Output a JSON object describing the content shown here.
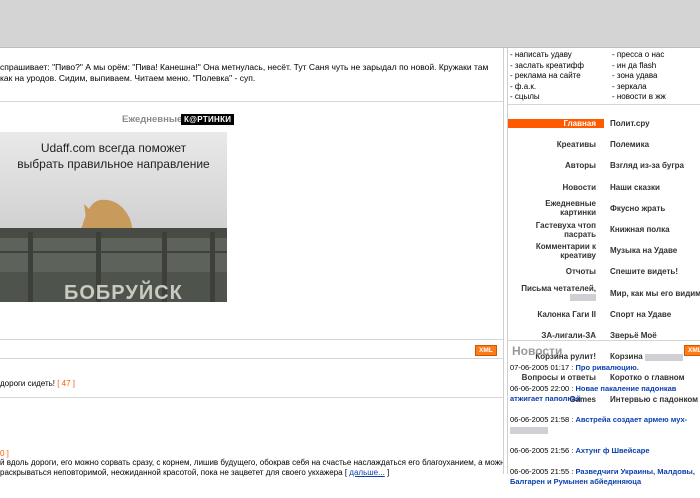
{
  "intro": {
    "line1": "спрашивает: \"Пиво?\" А мы орём: \"Пива! Канешна!\" Она метнулась, несёт. Тут Саня чуть не зарыдал по новой. Кружаки там",
    "line2": "как на уродов. Сидим, выпиваем. Читаем меню. \"Полевка\" - суп."
  },
  "pictures": {
    "title": "Ежедневные",
    "badge": "К@РТИНКИ",
    "caption_line1": "Udaff.com всегда поможет",
    "caption_line2": "выбрать правильное направление",
    "truck_text": "БОБРУЙСК"
  },
  "xml_label": "XML",
  "feed": {
    "item1_text": "дороги сидеть!",
    "item1_count": "[ 47 ]",
    "item2_num": "0 ]",
    "item2_line1": "й вдоль дороги, его можно сорвать сразу, с корнем, лишив будущего, обокрав себя на счастье наслаждаться его благоуханием, а можно",
    "item2_line2": "раскрываться неповторимой, неожиданной красотой, пока не зацветет для своего укхажера [",
    "item2_more": "дальше...",
    "item2_close": "]"
  },
  "top_links": {
    "left": [
      "- написать удаву",
      "- заслать креатифф",
      "- реклама на сайте",
      "- ф.а.к.",
      "- сцылы"
    ],
    "right": [
      "- пресса о нас",
      "- ин да flash",
      "- зона удава",
      "- зеркала",
      "- новости в жж"
    ]
  },
  "menu": [
    {
      "left": "Главная",
      "right": "Полит.сру"
    },
    {
      "left": "Креативы",
      "right": "Полемика"
    },
    {
      "left": "Авторы",
      "right": "Взгляд из-за бугра"
    },
    {
      "left": "Новости",
      "right": "Наши сказки"
    },
    {
      "left": "Ежедневные картинки",
      "right": "Фкусно жрать"
    },
    {
      "left": "Гастевуха чтоп пасрать",
      "right": "Книжная полка"
    },
    {
      "left": "Комментарии к креативу",
      "right": "Музыка на Удаве"
    },
    {
      "left": "Отчоты",
      "right": "Спешите видеть!"
    },
    {
      "left": "Письма четателей,",
      "right": "Мир, как мы его видим"
    },
    {
      "left": "Калонка Гаги II",
      "right": "Спорт на Удаве"
    },
    {
      "left": "ЗА-лигали-ЗА",
      "right": "Зверьё Моё"
    },
    {
      "left": "Корзина рулит!",
      "right": "Корзина"
    },
    {
      "left": "Вопросы и ответы",
      "right": "Коротко о главном"
    },
    {
      "left": "Games",
      "right": "Интервью с падонком"
    }
  ],
  "news": {
    "title": "Новости",
    "items": [
      {
        "date": "07-06-2005 01:17 :",
        "title": "Про ривалюцию."
      },
      {
        "date": "06-06-2005 22:00 :",
        "title": "Новае пакаление падонкав атжигает паполнай"
      },
      {
        "date": "06-06-2005 21:58 :",
        "title": "Австрейа создает армею мух-"
      },
      {
        "date": "06-06-2005 21:56 :",
        "title": "Ахтунг ф Швейсаре"
      },
      {
        "date": "06-06-2005 21:55 :",
        "title": "Разведчиги Украины, Малдовы, Балгарен и Румынен абйединяюца"
      }
    ]
  }
}
